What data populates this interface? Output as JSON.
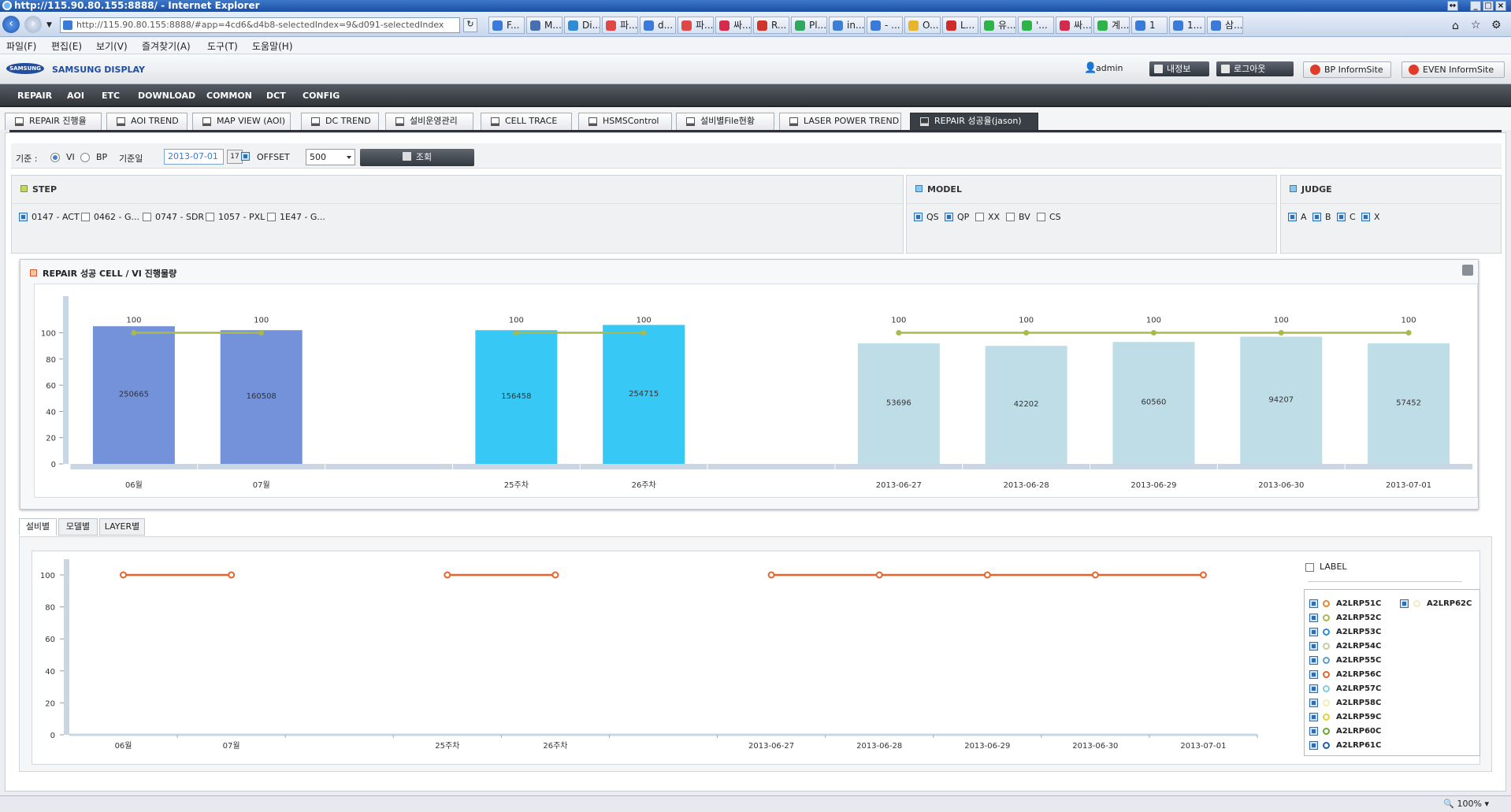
{
  "browser": {
    "title": "http://115.90.80.155:8888/ - Internet Explorer",
    "url": "http://115.90.80.155:8888/#app=4cd6&d4b8-selectedIndex=9&d091-selectedIndex",
    "tabs": [
      "F...",
      "M...",
      "Di...",
      "파...",
      "d...",
      "파...",
      "싸...",
      "R...",
      "Pl...",
      "in...",
      "- ...",
      "O...",
      "L...",
      "유...",
      "'...",
      "싸...",
      "계...",
      "1",
      "1...",
      "삼..."
    ],
    "menu": [
      "파일(F)",
      "편집(E)",
      "보기(V)",
      "즐겨찾기(A)",
      "도구(T)",
      "도움말(H)"
    ],
    "zoom": "100%"
  },
  "header": {
    "logo": "SAMSUNG",
    "brand": "SAMSUNG DISPLAY",
    "user": "admin",
    "myinfo": "내정보",
    "logout": "로그아웃",
    "bp_site": "BP InformSite",
    "even_site": "EVEN InformSite"
  },
  "topnav": [
    "REPAIR",
    "AOI",
    "ETC",
    "DOWNLOAD",
    "COMMON",
    "DCT",
    "CONFIG"
  ],
  "pagetabs": [
    "REPAIR 진행율",
    "AOI TREND",
    "MAP VIEW (AOI)",
    "DC TREND",
    "설비운영관리",
    "CELL TRACE",
    "HSMSControl",
    "설비별File현황",
    "LASER POWER TREND",
    "REPAIR 성공율(jason)"
  ],
  "filter": {
    "basis_label": "기준 :",
    "opt_vi": "VI",
    "opt_bp": "BP",
    "date_label": "기준일",
    "date": "2013-07-01",
    "offset_label": "OFFSET",
    "offset": "500",
    "search": "조회"
  },
  "panels": {
    "step": {
      "title": "STEP",
      "items": [
        "0147 - ACT",
        "0462 - G...",
        "0747 - SDR",
        "1057 - PXL",
        "1E47 - G..."
      ]
    },
    "model": {
      "title": "MODEL",
      "items": [
        "QS",
        "QP",
        "XX",
        "BV",
        "CS"
      ]
    },
    "judge": {
      "title": "JUDGE",
      "items": [
        "A",
        "B",
        "C",
        "X"
      ]
    }
  },
  "chart_title": "REPAIR 성공 CELL / VI 진행물량",
  "chart_data": [
    {
      "type": "bar",
      "title": "REPAIR 성공 CELL / VI 진행물량",
      "categories": [
        "06월",
        "07월",
        "",
        "25주차",
        "26주차",
        "",
        "2013-06-27",
        "2013-06-28",
        "2013-06-29",
        "2013-06-30",
        "2013-07-01"
      ],
      "bar_heights": [
        105,
        102,
        null,
        102,
        106,
        null,
        92,
        90,
        93,
        97,
        92
      ],
      "bar_labels": [
        "250665",
        "160508",
        "",
        "156458",
        "254715",
        "",
        "53696",
        "42202",
        "60560",
        "94207",
        "57452"
      ],
      "bar_colors": [
        "#7392d9",
        "#7392d9",
        null,
        "#37c8f5",
        "#37c8f5",
        null,
        "#bfdde6",
        "#bfdde6",
        "#bfdde6",
        "#bfdde6",
        "#bfdde6"
      ],
      "line_values": [
        100,
        100,
        null,
        100,
        100,
        null,
        100,
        100,
        100,
        100,
        100
      ],
      "line_color": "#a9b94a",
      "ylim": [
        0,
        100
      ],
      "yticks": [
        "0",
        "20",
        "40",
        "60",
        "80",
        "100"
      ]
    },
    {
      "type": "line",
      "categories": [
        "06월",
        "07월",
        "",
        "25주차",
        "26주차",
        "",
        "2013-06-27",
        "2013-06-28",
        "2013-06-29",
        "2013-06-30",
        "2013-07-01"
      ],
      "series": [
        {
          "name": "A2LRP56C",
          "values": [
            100,
            100,
            null,
            100,
            100,
            null,
            100,
            100,
            100,
            100,
            100
          ],
          "color": "#e8622b"
        }
      ],
      "ylim": [
        0,
        100
      ],
      "yticks": [
        "0",
        "20",
        "40",
        "60",
        "80",
        "100"
      ]
    }
  ],
  "subtabs": [
    "설비별",
    "모델별",
    "LAYER별"
  ],
  "legend": {
    "header": "LABEL",
    "items": [
      {
        "name": "A2LRP51C",
        "color": "#e8862b"
      },
      {
        "name": "A2LRP52C",
        "color": "#a9b94a"
      },
      {
        "name": "A2LRP53C",
        "color": "#2b8fd1"
      },
      {
        "name": "A2LRP54C",
        "color": "#c6cba0"
      },
      {
        "name": "A2LRP55C",
        "color": "#5b9fc9"
      },
      {
        "name": "A2LRP56C",
        "color": "#e8622b"
      },
      {
        "name": "A2LRP57C",
        "color": "#7fcbe6"
      },
      {
        "name": "A2LRP58C",
        "color": "#f2efb5"
      },
      {
        "name": "A2LRP59C",
        "color": "#e8d12b"
      },
      {
        "name": "A2LRP60C",
        "color": "#6aa82b"
      },
      {
        "name": "A2LRP61C",
        "color": "#1f5fa8"
      },
      {
        "name": "A2LRP62C",
        "color": "#f0ecc0"
      }
    ]
  }
}
